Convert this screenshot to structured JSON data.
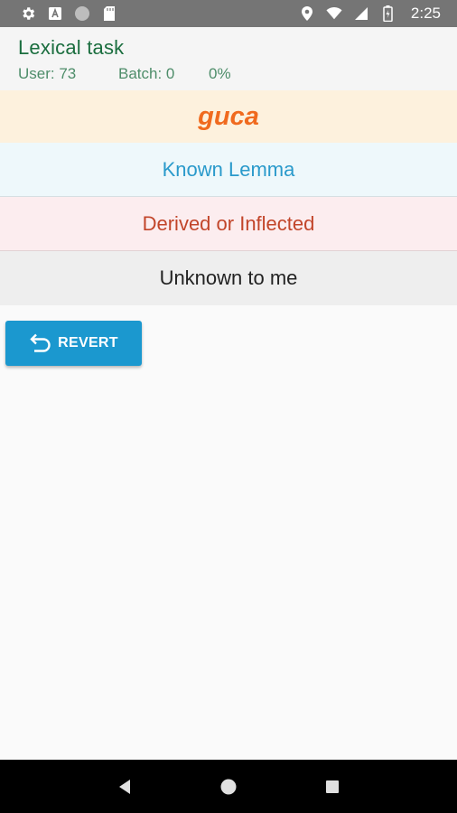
{
  "status_bar": {
    "time": "2:25",
    "icons_left": [
      "gear-icon",
      "font-download-icon",
      "circle-icon",
      "sd-card-icon"
    ],
    "icons_right": [
      "location-icon",
      "wifi-icon",
      "cell-signal-icon",
      "battery-icon"
    ]
  },
  "header": {
    "title": "Lexical task",
    "user": "User: 73",
    "batch": "Batch: 0",
    "progress": "0%"
  },
  "word": "guca",
  "options": {
    "known": "Known Lemma",
    "derived": "Derived or Inflected",
    "unknown": "Unknown to me"
  },
  "revert_button": {
    "label": "REVERT",
    "icon": "undo-icon"
  },
  "nav_bar": {
    "icons": [
      "back-icon",
      "home-icon",
      "recents-icon"
    ]
  },
  "colors": {
    "status_bar": "#757575",
    "title": "#1b6e3f",
    "word": "#f06a1e",
    "known": "#2a9acb",
    "derived": "#c2452a",
    "button": "#1b98cf"
  }
}
